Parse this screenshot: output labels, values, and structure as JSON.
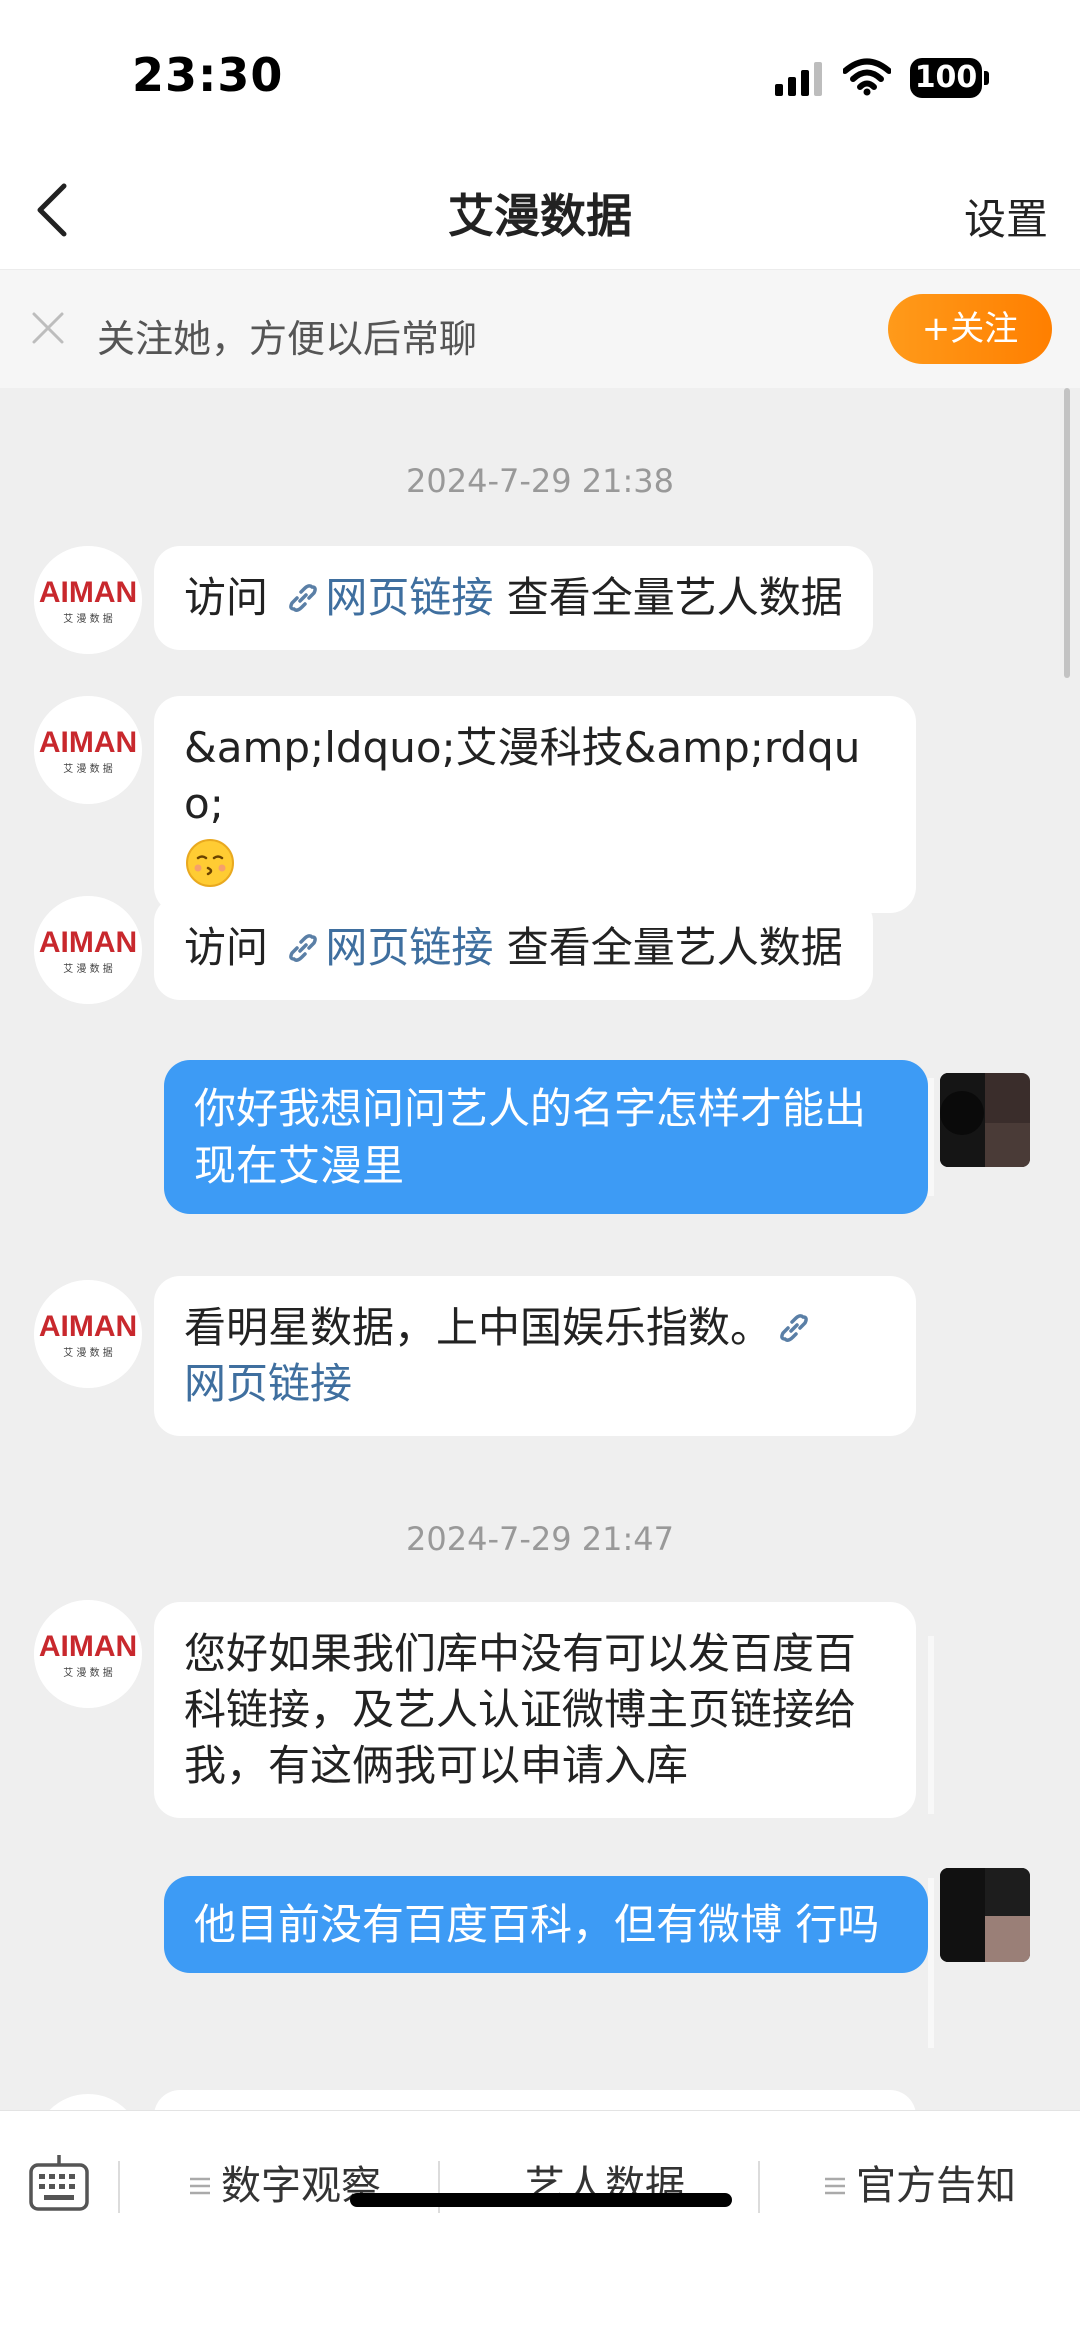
{
  "status_bar": {
    "time": "23:30",
    "battery": "100"
  },
  "nav": {
    "title": "艾漫数据",
    "settings_label": "设置"
  },
  "follow_banner": {
    "text": "关注她，方便以后常聊",
    "button_label": "+关注"
  },
  "avatar_logo": {
    "text": "AIMAN",
    "sub": "艾 漫 数 据"
  },
  "timestamps": [
    "2024-7-29 21:38",
    "2024-7-29 21:47"
  ],
  "messages": [
    {
      "from": "bot",
      "prefix": "访问 ",
      "link": "网页链接",
      "suffix": " 查看全量艺人数据"
    },
    {
      "from": "bot",
      "text": "&amp;ldquo;艾漫科技&amp;rdquo;",
      "emoji": "kissing-face"
    },
    {
      "from": "bot",
      "prefix": "访问 ",
      "link": "网页链接",
      "suffix": " 查看全量艺人数据"
    },
    {
      "from": "user",
      "text": "你好我想问问艺人的名字怎样才能出现在艾漫里"
    },
    {
      "from": "bot",
      "text": "看明星数据，上中国娱乐指数。",
      "link": "网页链接"
    },
    {
      "from": "bot",
      "text": "您好如果我们库中没有可以发百度百科链接，及艺人认证微博主页链接给我，有这俩我可以申请入库"
    },
    {
      "from": "user",
      "text": "他目前没有百度百科，但有微博 行吗"
    }
  ],
  "bottom_menu": {
    "items": [
      "数字观察",
      "艺人数据",
      "官方告知"
    ]
  },
  "colors": {
    "accent_orange": "#ff8a00",
    "bubble_blue": "#3d9bf5",
    "link_blue": "#3f6f9f",
    "chat_bg": "#efefef"
  }
}
